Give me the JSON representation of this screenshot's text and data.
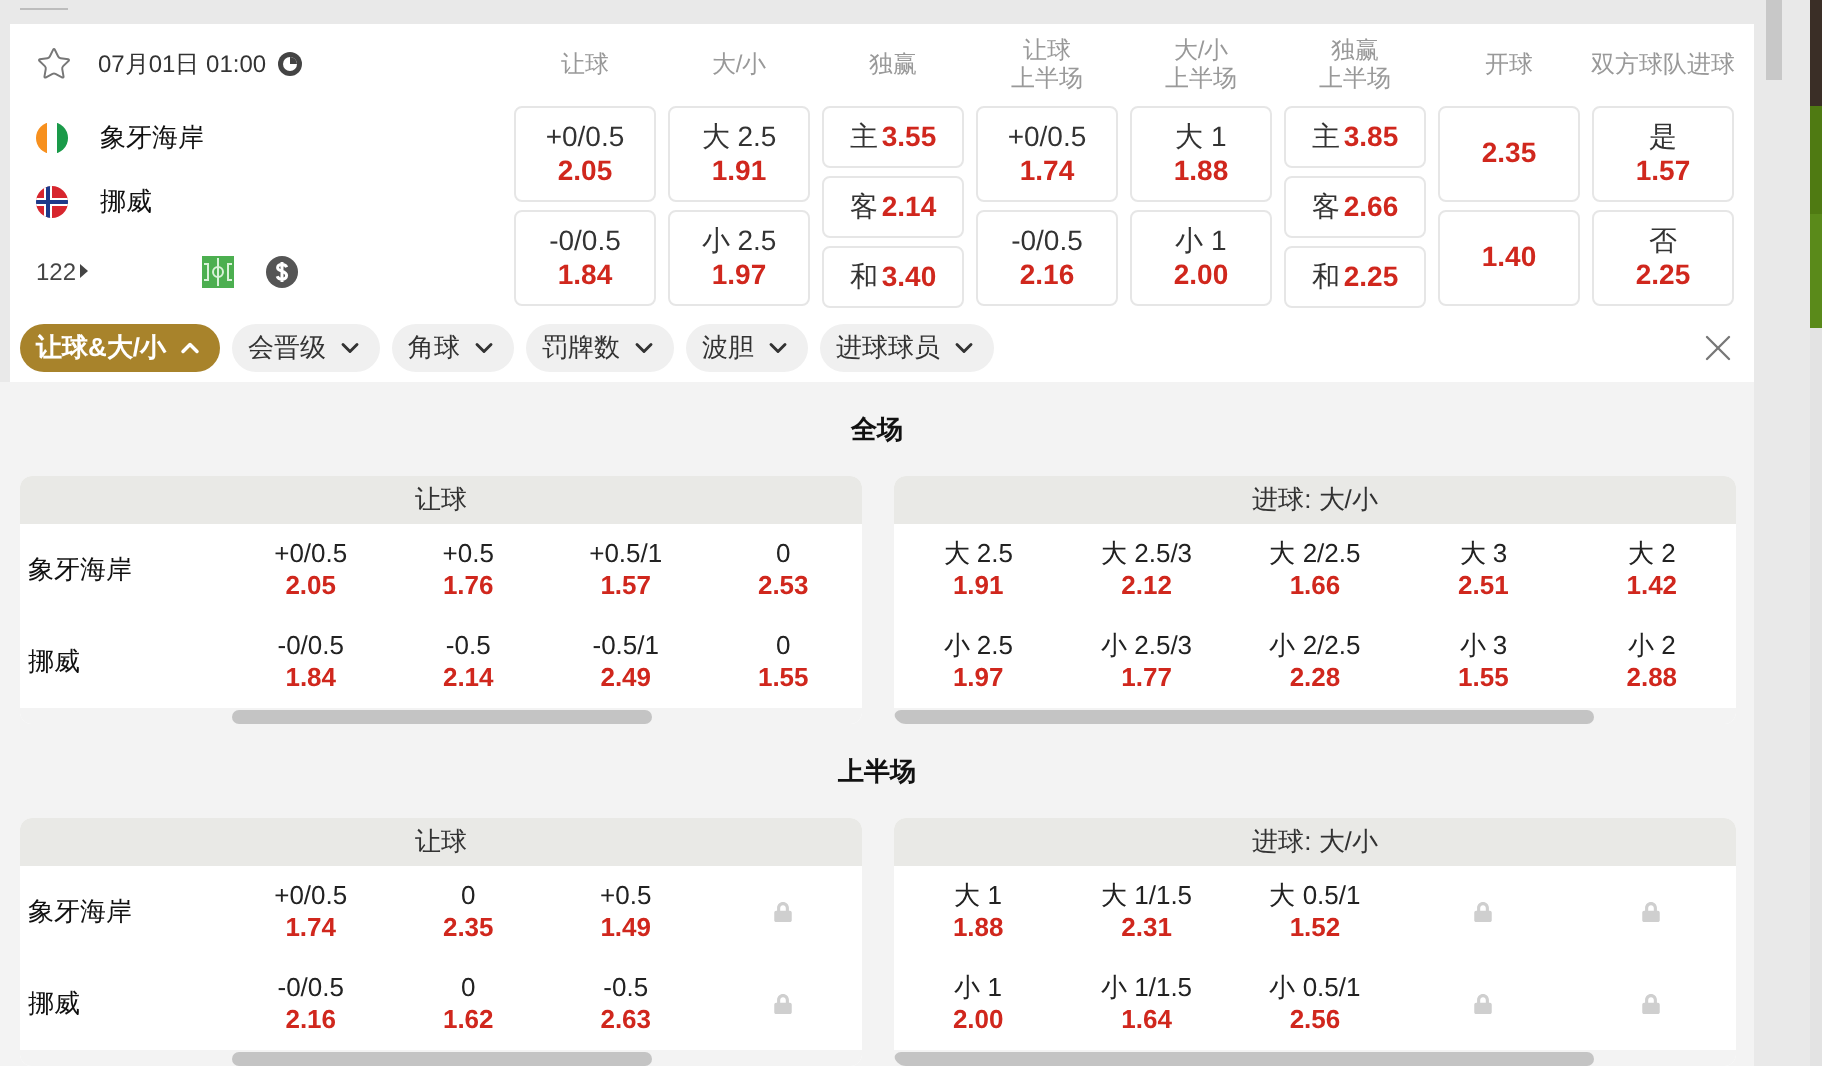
{
  "match": {
    "favorite": false,
    "date_time": "07月01日 01:00",
    "home": {
      "name": "象牙海岸"
    },
    "away": {
      "name": "挪威"
    },
    "more_count": "122"
  },
  "odds_columns": [
    {
      "header": [
        "让球"
      ],
      "kind": "pair",
      "cells": [
        {
          "line": "+0/0.5",
          "odds": "2.05"
        },
        {
          "line": "-0/0.5",
          "odds": "1.84"
        }
      ]
    },
    {
      "header": [
        "大/小"
      ],
      "kind": "pair",
      "cells": [
        {
          "line": "大 2.5",
          "odds": "1.91"
        },
        {
          "line": "小 2.5",
          "odds": "1.97"
        }
      ]
    },
    {
      "header": [
        "独赢"
      ],
      "kind": "triple",
      "cells": [
        {
          "line": "主",
          "odds": "3.55"
        },
        {
          "line": "客",
          "odds": "2.14"
        },
        {
          "line": "和",
          "odds": "3.40"
        }
      ]
    },
    {
      "header": [
        "让球",
        "上半场"
      ],
      "kind": "pair",
      "cells": [
        {
          "line": "+0/0.5",
          "odds": "1.74"
        },
        {
          "line": "-0/0.5",
          "odds": "2.16"
        }
      ]
    },
    {
      "header": [
        "大/小",
        "上半场"
      ],
      "kind": "pair",
      "cells": [
        {
          "line": "大 1",
          "odds": "1.88"
        },
        {
          "line": "小 1",
          "odds": "2.00"
        }
      ]
    },
    {
      "header": [
        "独赢",
        "上半场"
      ],
      "kind": "triple",
      "cells": [
        {
          "line": "主",
          "odds": "3.85"
        },
        {
          "line": "客",
          "odds": "2.66"
        },
        {
          "line": "和",
          "odds": "2.25"
        }
      ]
    },
    {
      "header": [
        "开球"
      ],
      "kind": "pair",
      "cells": [
        {
          "odds": "2.35"
        },
        {
          "odds": "1.40"
        }
      ]
    },
    {
      "header": [
        "双方球队进球"
      ],
      "kind": "pair",
      "cells": [
        {
          "line": "是",
          "odds": "1.57"
        },
        {
          "line": "否",
          "odds": "2.25"
        }
      ]
    }
  ],
  "filters": [
    {
      "label": "让球&大/小",
      "selected": true
    },
    {
      "label": "会晋级",
      "selected": false
    },
    {
      "label": "角球",
      "selected": false
    },
    {
      "label": "罚牌数",
      "selected": false
    },
    {
      "label": "波胆",
      "selected": false
    },
    {
      "label": "进球球员",
      "selected": false
    }
  ],
  "sections": [
    {
      "title": "全场",
      "panels": [
        {
          "title": "让球",
          "kind": "teams",
          "rows": [
            {
              "team": "象牙海岸",
              "cells": [
                {
                  "kind": "odds",
                  "line": "+0/0.5",
                  "odds": "2.05"
                },
                {
                  "kind": "odds",
                  "line": "+0.5",
                  "odds": "1.76"
                },
                {
                  "kind": "odds",
                  "line": "+0.5/1",
                  "odds": "1.57"
                },
                {
                  "kind": "odds",
                  "line": "0",
                  "odds": "2.53"
                }
              ]
            },
            {
              "team": "挪威",
              "cells": [
                {
                  "kind": "odds",
                  "line": "-0/0.5",
                  "odds": "1.84"
                },
                {
                  "kind": "odds",
                  "line": "-0.5",
                  "odds": "2.14"
                },
                {
                  "kind": "odds",
                  "line": "-0.5/1",
                  "odds": "2.49"
                },
                {
                  "kind": "odds",
                  "line": "0",
                  "odds": "1.55"
                }
              ]
            }
          ]
        },
        {
          "title": "进球: 大/小",
          "kind": "plain",
          "rows": [
            {
              "cells": [
                {
                  "kind": "odds",
                  "line": "大 2.5",
                  "odds": "1.91"
                },
                {
                  "kind": "odds",
                  "line": "大 2.5/3",
                  "odds": "2.12"
                },
                {
                  "kind": "odds",
                  "line": "大 2/2.5",
                  "odds": "1.66"
                },
                {
                  "kind": "odds",
                  "line": "大 3",
                  "odds": "2.51"
                },
                {
                  "kind": "odds",
                  "line": "大 2",
                  "odds": "1.42"
                }
              ]
            },
            {
              "cells": [
                {
                  "kind": "odds",
                  "line": "小 2.5",
                  "odds": "1.97"
                },
                {
                  "kind": "odds",
                  "line": "小 2.5/3",
                  "odds": "1.77"
                },
                {
                  "kind": "odds",
                  "line": "小 2/2.5",
                  "odds": "2.28"
                },
                {
                  "kind": "odds",
                  "line": "小 3",
                  "odds": "1.55"
                },
                {
                  "kind": "odds",
                  "line": "小 2",
                  "odds": "2.88"
                }
              ]
            }
          ]
        }
      ]
    },
    {
      "title": "上半场",
      "panels": [
        {
          "title": "让球",
          "kind": "teams",
          "rows": [
            {
              "team": "象牙海岸",
              "cells": [
                {
                  "kind": "odds",
                  "line": "+0/0.5",
                  "odds": "1.74"
                },
                {
                  "kind": "odds",
                  "line": "0",
                  "odds": "2.35"
                },
                {
                  "kind": "odds",
                  "line": "+0.5",
                  "odds": "1.49"
                },
                {
                  "kind": "locked"
                }
              ]
            },
            {
              "team": "挪威",
              "cells": [
                {
                  "kind": "odds",
                  "line": "-0/0.5",
                  "odds": "2.16"
                },
                {
                  "kind": "odds",
                  "line": "0",
                  "odds": "1.62"
                },
                {
                  "kind": "odds",
                  "line": "-0.5",
                  "odds": "2.63"
                },
                {
                  "kind": "locked"
                }
              ]
            }
          ]
        },
        {
          "title": "进球: 大/小",
          "kind": "plain",
          "rows": [
            {
              "cells": [
                {
                  "kind": "odds",
                  "line": "大 1",
                  "odds": "1.88"
                },
                {
                  "kind": "odds",
                  "line": "大 1/1.5",
                  "odds": "2.31"
                },
                {
                  "kind": "odds",
                  "line": "大 0.5/1",
                  "odds": "1.52"
                },
                {
                  "kind": "locked"
                },
                {
                  "kind": "locked"
                }
              ]
            },
            {
              "cells": [
                {
                  "kind": "odds",
                  "line": "小 1",
                  "odds": "2.00"
                },
                {
                  "kind": "odds",
                  "line": "小 1/1.5",
                  "odds": "1.64"
                },
                {
                  "kind": "odds",
                  "line": "小 0.5/1",
                  "odds": "2.56"
                },
                {
                  "kind": "locked"
                },
                {
                  "kind": "locked"
                }
              ]
            }
          ]
        }
      ]
    }
  ]
}
